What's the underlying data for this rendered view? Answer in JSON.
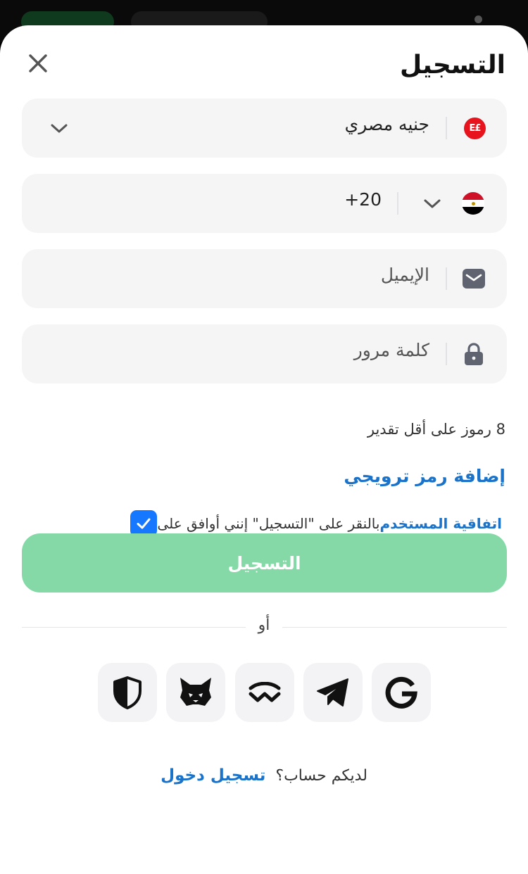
{
  "header": {
    "title": "التسجيل"
  },
  "currency": {
    "symbol": "E£",
    "label": "جنيه مصري"
  },
  "phone": {
    "code": "+20"
  },
  "email": {
    "placeholder": "الإيميل"
  },
  "password": {
    "placeholder": "كلمة مرور",
    "hint": "8 رموز على أقل تقدير"
  },
  "promo": {
    "link": "إضافة رمز ترويجي"
  },
  "agreement": {
    "checked": true,
    "text": "بالنقر على \"التسجيل\" إنني أوافق على",
    "link": "اتفاقية المستخدم"
  },
  "submit": {
    "label": "التسجيل"
  },
  "divider": {
    "text": "أو"
  },
  "social": [
    "google-icon",
    "telegram-icon",
    "walletconnect-icon",
    "metamask-icon",
    "shield-wallet-icon"
  ],
  "footer": {
    "question": "لديكم حساب؟",
    "login_link": "تسجيل دخول"
  },
  "colors": {
    "accent": "#1a73c9",
    "checkbox": "#1677ff",
    "submit_disabled": "#84d9a6",
    "field_bg": "#f5f5f6"
  }
}
